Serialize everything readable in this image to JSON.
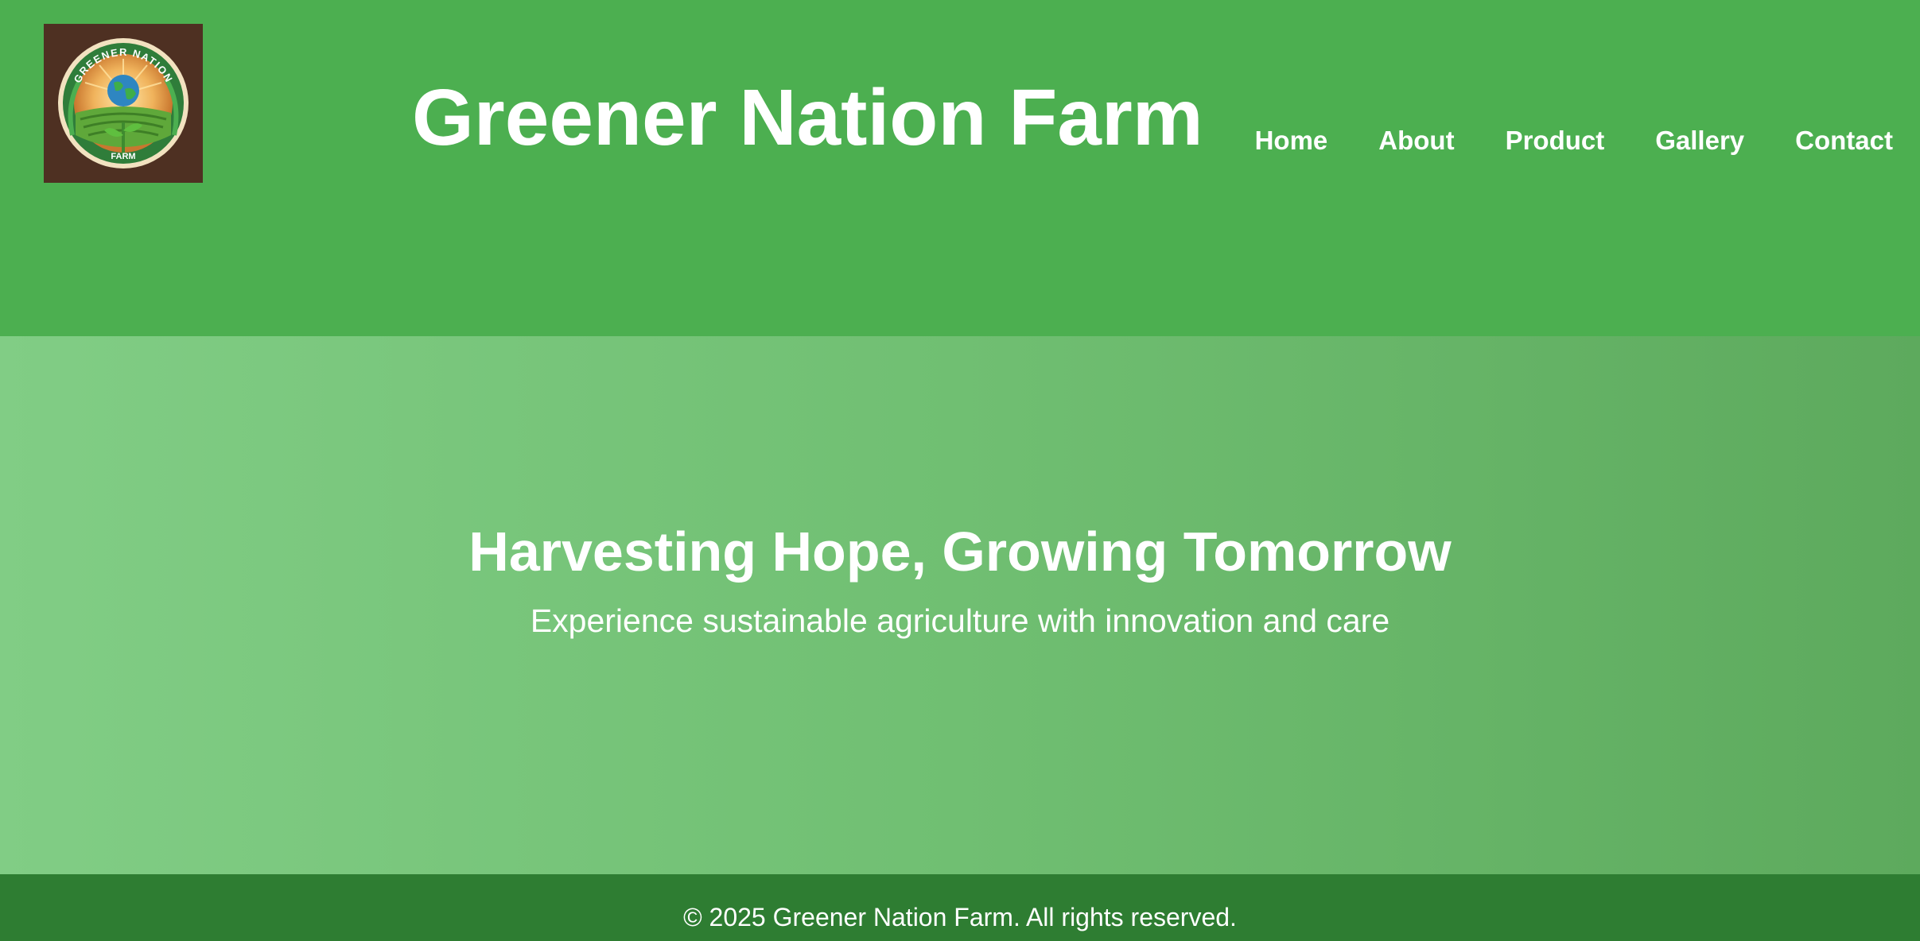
{
  "header": {
    "logo_icon": "greener-nation-farm-logo",
    "logo_text_top": "GREENER NATION",
    "logo_text_bottom": "FARM",
    "title": "Greener Nation Farm",
    "nav": [
      {
        "label": "Home"
      },
      {
        "label": "About"
      },
      {
        "label": "Product"
      },
      {
        "label": "Gallery"
      },
      {
        "label": "Contact"
      }
    ]
  },
  "hero": {
    "title": "Harvesting Hope, Growing Tomorrow",
    "subtitle": "Experience sustainable agriculture with innovation and care"
  },
  "footer": {
    "copyright": "© 2025 Greener Nation Farm. All rights reserved."
  },
  "colors": {
    "header_bg": "#4caf50",
    "hero_gradient_start": "#81cd85",
    "hero_gradient_end": "#5daa5d",
    "footer_bg": "#2e7d32",
    "text": "#ffffff"
  }
}
